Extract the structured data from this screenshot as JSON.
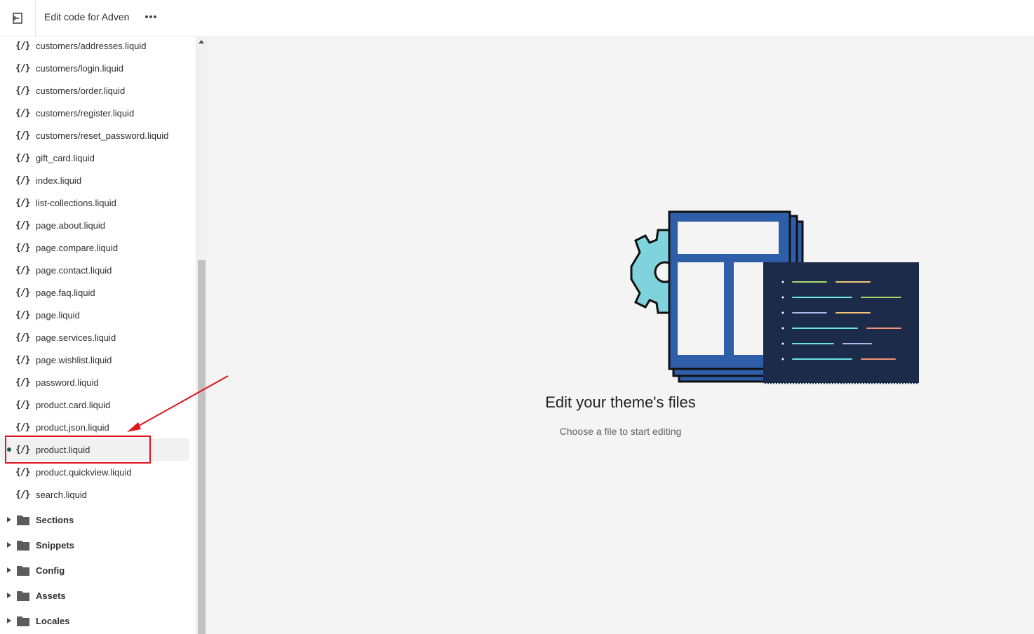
{
  "topbar": {
    "exit_icon": "exit-icon",
    "title": "Edit code for Adven",
    "more_icon": "more-horizontal-icon"
  },
  "sidebar": {
    "files": [
      {
        "icon": "{/}",
        "label": "customers/addresses.liquid"
      },
      {
        "icon": "{/}",
        "label": "customers/login.liquid"
      },
      {
        "icon": "{/}",
        "label": "customers/order.liquid"
      },
      {
        "icon": "{/}",
        "label": "customers/register.liquid"
      },
      {
        "icon": "{/}",
        "label": "customers/reset_password.liquid"
      },
      {
        "icon": "{/}",
        "label": "gift_card.liquid"
      },
      {
        "icon": "{/}",
        "label": "index.liquid"
      },
      {
        "icon": "{/}",
        "label": "list-collections.liquid"
      },
      {
        "icon": "{/}",
        "label": "page.about.liquid"
      },
      {
        "icon": "{/}",
        "label": "page.compare.liquid"
      },
      {
        "icon": "{/}",
        "label": "page.contact.liquid"
      },
      {
        "icon": "{/}",
        "label": "page.faq.liquid"
      },
      {
        "icon": "{/}",
        "label": "page.liquid"
      },
      {
        "icon": "{/}",
        "label": "page.services.liquid"
      },
      {
        "icon": "{/}",
        "label": "page.wishlist.liquid"
      },
      {
        "icon": "{/}",
        "label": "password.liquid"
      },
      {
        "icon": "{/}",
        "label": "product.card.liquid"
      },
      {
        "icon": "{/}",
        "label": "product.json.liquid"
      },
      {
        "icon": "{/}",
        "label": "product.liquid",
        "selected": true
      },
      {
        "icon": "{/}",
        "label": "product.quickview.liquid"
      },
      {
        "icon": "{/}",
        "label": "search.liquid"
      }
    ],
    "folders": [
      {
        "label": "Sections"
      },
      {
        "label": "Snippets"
      },
      {
        "label": "Config"
      },
      {
        "label": "Assets"
      },
      {
        "label": "Locales"
      }
    ]
  },
  "main": {
    "title": "Edit your theme's files",
    "subtitle": "Choose a file to start editing",
    "illustration": "theme-code-illustration"
  },
  "colors": {
    "annotation": "#e0141e",
    "selected_dot": "#1a5c4b",
    "illustration_blue": "#2f5ea8",
    "illustration_navy": "#1c2b4a",
    "illustration_gear": "#7fd3dc"
  }
}
